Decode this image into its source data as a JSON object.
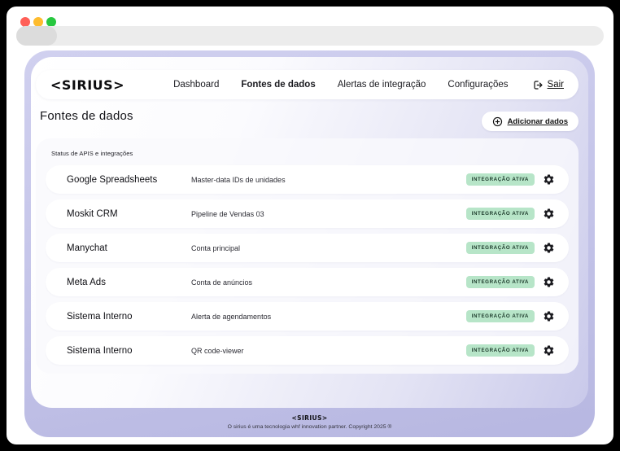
{
  "browser": {
    "traffic_lights": {
      "close": "#ff5f57",
      "minimize": "#febc2e",
      "zoom": "#28c840"
    }
  },
  "header": {
    "logo": "<SIRIUS>",
    "nav": [
      {
        "label": "Dashboard",
        "active": false
      },
      {
        "label": "Fontes de dados",
        "active": true
      },
      {
        "label": "Alertas de integração",
        "active": false
      },
      {
        "label": "Configurações",
        "active": false
      }
    ],
    "logout_label": "Sair"
  },
  "page": {
    "title": "Fontes de dados",
    "add_button_label": "Adicionar dados",
    "card_label": "Status de APIS e integrações",
    "rows": [
      {
        "name": "Google Spreadsheets",
        "description": "Master-data IDs de unidades",
        "status": "INTEGRAÇÃO ATIVA"
      },
      {
        "name": "Moskit CRM",
        "description": "Pipeline de Vendas 03",
        "status": "INTEGRAÇÃO ATIVA"
      },
      {
        "name": "Manychat",
        "description": "Conta principal",
        "status": "INTEGRAÇÃO ATIVA"
      },
      {
        "name": "Meta Ads",
        "description": "Conta de anúncios",
        "status": "INTEGRAÇÃO ATIVA"
      },
      {
        "name": "Sistema Interno",
        "description": "Alerta de agendamentos",
        "status": "INTEGRAÇÃO ATIVA"
      },
      {
        "name": "Sistema Interno",
        "description": "QR code-viewer",
        "status": "INTEGRAÇÃO ATIVA"
      }
    ]
  },
  "footer": {
    "logo": "<SIRIUS>",
    "copyright": "O sirius é uma tecnologia whf innovation partner. Copyright 2025 ®"
  },
  "colors": {
    "badge_bg": "#b7e5c8",
    "badge_text": "#1c3a2b",
    "lavender": "#c3c3e8"
  }
}
